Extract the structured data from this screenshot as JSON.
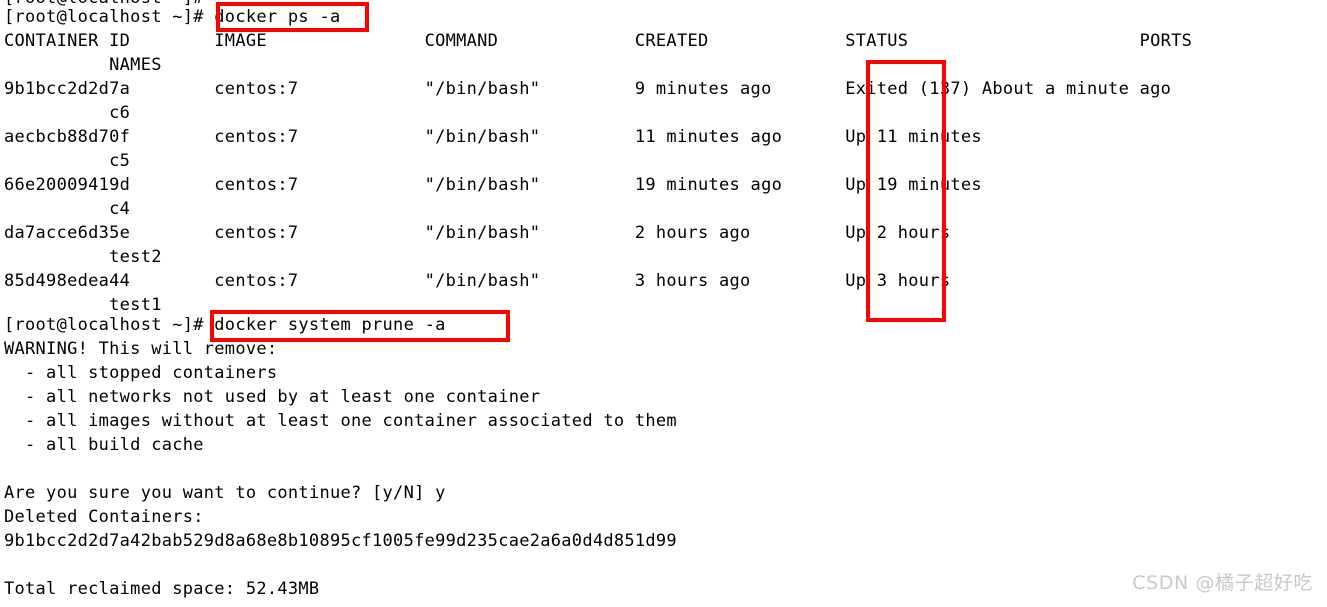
{
  "terminal": {
    "prompt": "[root@localhost ~]#",
    "clipped_top_line": "[root@localhost ~]#",
    "commands": {
      "ps": "docker ps -a",
      "prune": "docker system prune -a"
    },
    "line_ps_command": "[root@localhost ~]# docker ps -a",
    "line_prune_command": "[root@localhost ~]# docker system prune -a",
    "table": {
      "headers": [
        "CONTAINER ID",
        "IMAGE",
        "COMMAND",
        "CREATED",
        "STATUS",
        "PORTS",
        "NAMES"
      ],
      "header_line_1": "CONTAINER ID        IMAGE               COMMAND             CREATED             STATUS                      PORTS",
      "header_line_2": "          NAMES",
      "rows": [
        {
          "container_id": "9b1bcc2d2d7a",
          "image": "centos:7",
          "command": "\"/bin/bash\"",
          "created": "9 minutes ago",
          "status": "Exited (137) About a minute ago",
          "ports": "",
          "names": "c6",
          "line_1": "9b1bcc2d2d7a        centos:7            \"/bin/bash\"         9 minutes ago       Exited (137) About a minute ago",
          "line_2": "          c6"
        },
        {
          "container_id": "aecbcb88d70f",
          "image": "centos:7",
          "command": "\"/bin/bash\"",
          "created": "11 minutes ago",
          "status": "Up 11 minutes",
          "ports": "",
          "names": "c5",
          "line_1": "aecbcb88d70f        centos:7            \"/bin/bash\"         11 minutes ago      Up 11 minutes",
          "line_2": "          c5"
        },
        {
          "container_id": "66e20009419d",
          "image": "centos:7",
          "command": "\"/bin/bash\"",
          "created": "19 minutes ago",
          "status": "Up 19 minutes",
          "ports": "",
          "names": "c4",
          "line_1": "66e20009419d        centos:7            \"/bin/bash\"         19 minutes ago      Up 19 minutes",
          "line_2": "          c4"
        },
        {
          "container_id": "da7acce6d35e",
          "image": "centos:7",
          "command": "\"/bin/bash\"",
          "created": "2 hours ago",
          "status": "Up 2 hours",
          "ports": "",
          "names": "test2",
          "line_1": "da7acce6d35e        centos:7            \"/bin/bash\"         2 hours ago         Up 2 hours",
          "line_2": "          test2"
        },
        {
          "container_id": "85d498edea44",
          "image": "centos:7",
          "command": "\"/bin/bash\"",
          "created": "3 hours ago",
          "status": "Up 3 hours",
          "ports": "",
          "names": "test1",
          "line_1": "85d498edea44        centos:7            \"/bin/bash\"         3 hours ago         Up 3 hours",
          "line_2": "          test1"
        }
      ]
    },
    "prune_output": {
      "warning": "WARNING! This will remove:",
      "items": [
        "  - all stopped containers",
        "  - all networks not used by at least one container",
        "  - all images without at least one container associated to them",
        "  - all build cache"
      ],
      "blank_1": "",
      "confirm": "Are you sure you want to continue? [y/N] y",
      "deleted_header": "Deleted Containers:",
      "deleted_id": "9b1bcc2d2d7a42bab529d8a68e8b10895cf1005fe99d235cae2a6a0d4d851d99",
      "blank_2": "",
      "total": "Total reclaimed space: 52.43MB"
    }
  },
  "annotations": {
    "boxes": [
      {
        "name": "ps-command-highlight",
        "label": "docker ps -a"
      },
      {
        "name": "status-column-highlight",
        "label": "STATUS column"
      },
      {
        "name": "prune-command-highlight",
        "label": "docker system prune -a"
      }
    ],
    "color": "#ff0000"
  },
  "watermark": {
    "text": "CSDN @橘子超好吃",
    "color": "#c9c9c9"
  }
}
